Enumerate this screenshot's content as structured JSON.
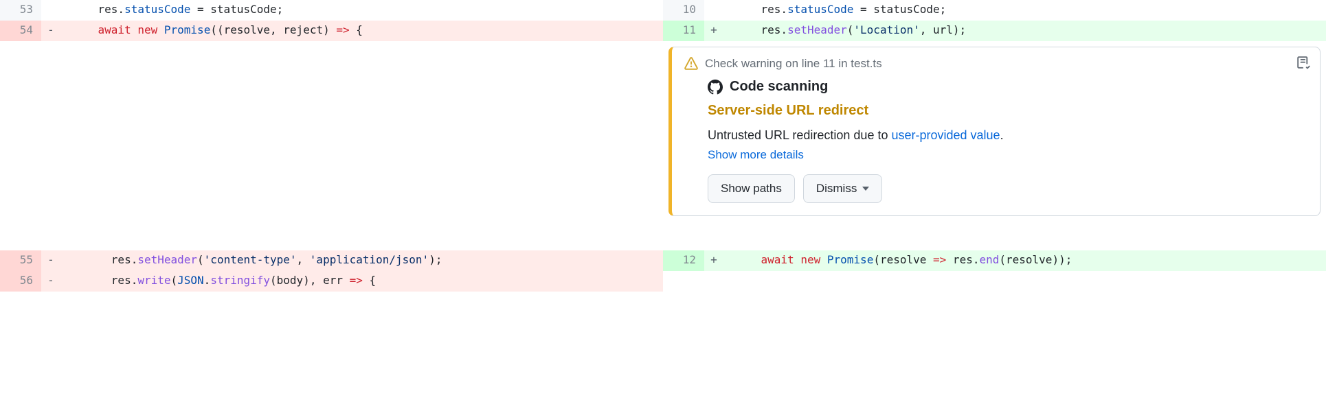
{
  "left": {
    "rows": [
      {
        "num": "53",
        "marker": "",
        "bg": "ctx",
        "tokens": [
          [
            "id",
            "    res."
          ],
          [
            "prop",
            "statusCode"
          ],
          [
            "id",
            " = statusCode;"
          ]
        ]
      },
      {
        "num": "54",
        "marker": "-",
        "bg": "del",
        "tokens": [
          [
            "id",
            "    "
          ],
          [
            "kw",
            "await"
          ],
          [
            "id",
            " "
          ],
          [
            "kw",
            "new"
          ],
          [
            "id",
            " "
          ],
          [
            "const",
            "Promise"
          ],
          [
            "id",
            "((resolve, reject) "
          ],
          [
            "kw",
            "=>"
          ],
          [
            "id",
            " {"
          ]
        ]
      },
      {
        "num": "55",
        "marker": "-",
        "bg": "del",
        "tokens": [
          [
            "id",
            "      res."
          ],
          [
            "fn",
            "setHeader"
          ],
          [
            "id",
            "("
          ],
          [
            "str",
            "'content-type'"
          ],
          [
            "id",
            ", "
          ],
          [
            "str",
            "'application/json'"
          ],
          [
            "id",
            ");"
          ]
        ]
      },
      {
        "num": "56",
        "marker": "-",
        "bg": "del",
        "tokens": [
          [
            "id",
            "      res."
          ],
          [
            "fn",
            "write"
          ],
          [
            "id",
            "("
          ],
          [
            "const",
            "JSON"
          ],
          [
            "id",
            "."
          ],
          [
            "fn",
            "stringify"
          ],
          [
            "id",
            "(body), err "
          ],
          [
            "kw",
            "=>"
          ],
          [
            "id",
            " {"
          ]
        ]
      }
    ]
  },
  "right": {
    "rows": [
      {
        "num": "10",
        "marker": "",
        "bg": "ctx",
        "tokens": [
          [
            "id",
            "    res."
          ],
          [
            "prop",
            "statusCode"
          ],
          [
            "id",
            " = statusCode;"
          ]
        ]
      },
      {
        "num": "11",
        "marker": "+",
        "bg": "add",
        "tokens": [
          [
            "id",
            "    res."
          ],
          [
            "fn",
            "setHeader"
          ],
          [
            "id",
            "("
          ],
          [
            "str",
            "'Location'"
          ],
          [
            "id",
            ", url);"
          ]
        ]
      },
      {
        "num": "12",
        "marker": "+",
        "bg": "add",
        "tokens": [
          [
            "id",
            "    "
          ],
          [
            "kw",
            "await"
          ],
          [
            "id",
            " "
          ],
          [
            "kw",
            "new"
          ],
          [
            "id",
            " "
          ],
          [
            "const",
            "Promise"
          ],
          [
            "id",
            "(resolve "
          ],
          [
            "kw",
            "=>"
          ],
          [
            "id",
            " res."
          ],
          [
            "fn",
            "end"
          ],
          [
            "id",
            "(resolve));"
          ]
        ]
      }
    ]
  },
  "annotation": {
    "header_text": "Check warning on line 11 in test.ts",
    "source_label": "Code scanning",
    "title": "Server-side URL redirect",
    "description_pre": "Untrusted URL redirection due to ",
    "description_link": "user-provided value",
    "description_post": ".",
    "show_more": "Show more details",
    "show_paths_label": "Show paths",
    "dismiss_label": "Dismiss"
  }
}
